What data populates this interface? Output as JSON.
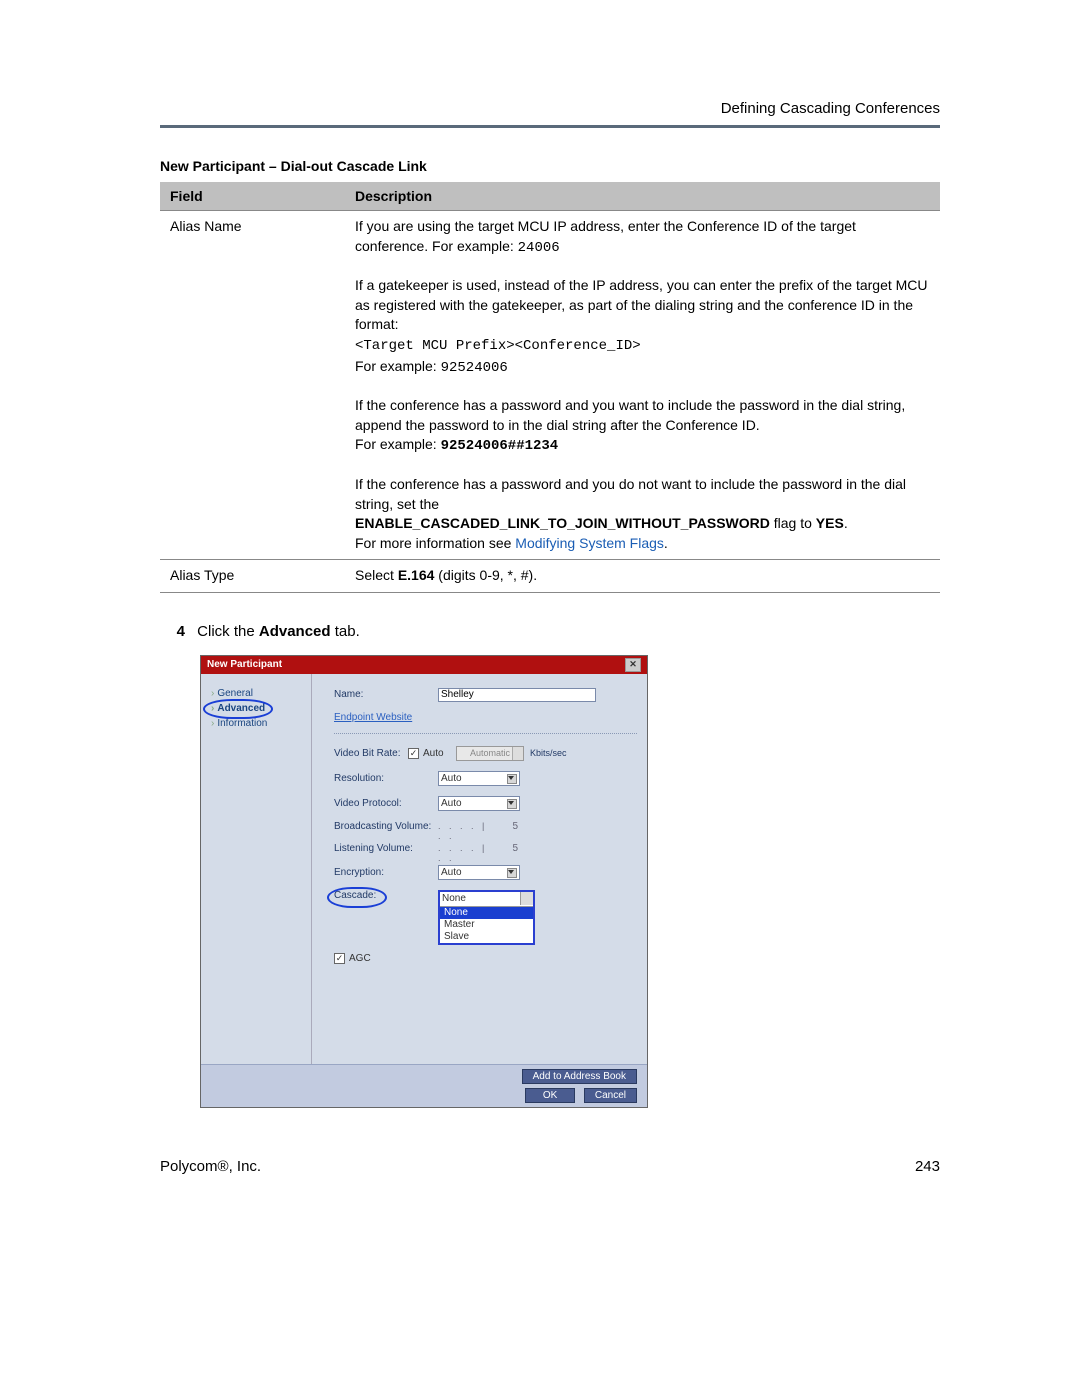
{
  "header": {
    "section": "Defining Cascading Conferences"
  },
  "table": {
    "title": "New Participant – Dial-out Cascade Link",
    "headers": {
      "field": "Field",
      "description": "Description"
    },
    "rows": {
      "aliasName": {
        "field": "Alias Name",
        "p1a": "If you are using the target MCU IP address, enter the Conference ID of the target conference. For example: ",
        "p1code": "24006",
        "p2": "If a gatekeeper is used, instead of the IP address, you can enter the prefix of the target MCU as registered with the gatekeeper, as part of the dialing string and the conference ID in the format:",
        "p2format": "<Target MCU Prefix><Conference_ID>",
        "p2ex_pre": "For example: ",
        "p2ex_code": "92524006",
        "p3": "If the conference has a password and you want to include the password in the dial string, append the password to in the dial string after the Conference ID.",
        "p3ex_pre": "For example: ",
        "p3ex_code": "92524006##1234",
        "p4": "If the conference has a password and you do not want to include the password in the dial string, set the",
        "p4flag": "ENABLE_CASCADED_LINK_TO_JOIN_WITHOUT_PASSWORD",
        "p4tail": " flag to ",
        "p4yes": "YES",
        "p4dot": ".",
        "p5pre": "For more information see ",
        "p5link": "Modifying System Flags",
        "p5dot": "."
      },
      "aliasType": {
        "field": "Alias Type",
        "d1": "Select ",
        "d2": "E.164",
        "d3": " (digits 0-9, *, #)."
      }
    }
  },
  "step": {
    "num": "4",
    "text_a": "Click the ",
    "text_b": "Advanced",
    "text_c": " tab."
  },
  "dialog": {
    "title": "New Participant",
    "nav": {
      "general": "General",
      "advanced": "Advanced",
      "information": "Information"
    },
    "fields": {
      "name_label": "Name:",
      "name_value": "Shelley",
      "endpoint_link": "Endpoint Website",
      "video_bitrate_label": "Video Bit Rate:",
      "auto_label": "Auto",
      "bitrate_value": "Automatic",
      "kbits": "Kbits/sec",
      "resolution_label": "Resolution:",
      "resolution_value": "Auto",
      "video_protocol_label": "Video Protocol:",
      "video_protocol_value": "Auto",
      "broadcast_label": "Broadcasting Volume:",
      "broadcast_value": "5",
      "listening_label": "Listening Volume:",
      "listening_value": "5",
      "encryption_label": "Encryption:",
      "encryption_value": "Auto",
      "cascade_label": "Cascade:",
      "cascade_value": "None",
      "cascade_options": {
        "none": "None",
        "master": "Master",
        "slave": "Slave"
      },
      "agc_label": "AGC"
    },
    "footer": {
      "add": "Add to Address Book",
      "ok": "OK",
      "cancel": "Cancel"
    }
  },
  "footer": {
    "company": "Polycom®, Inc.",
    "page": "243"
  }
}
